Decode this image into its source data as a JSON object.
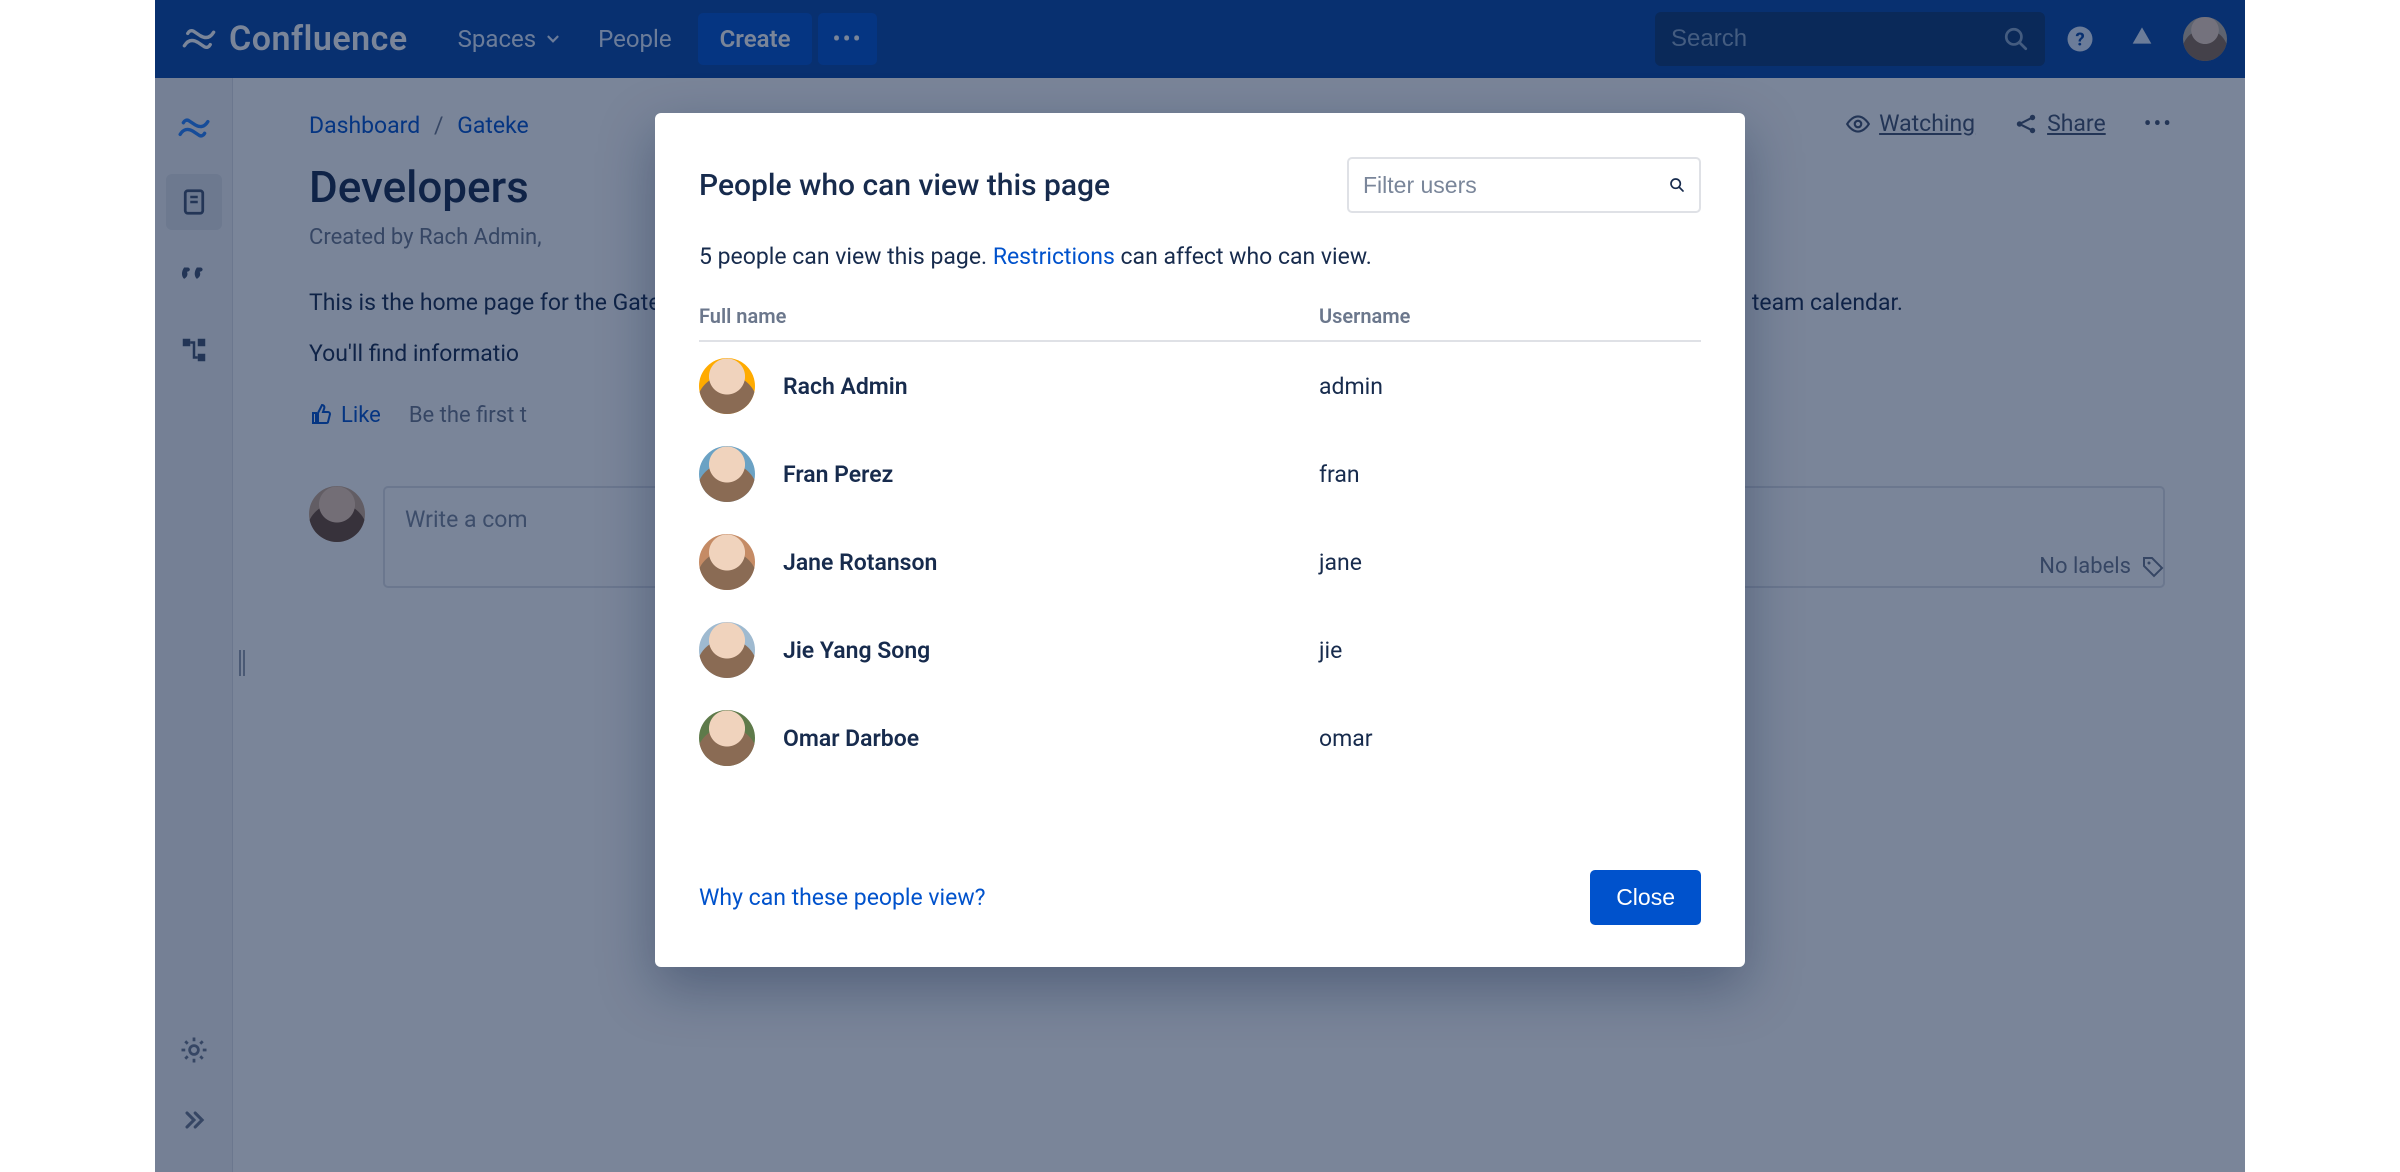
{
  "topnav": {
    "logo_text": "Confluence",
    "spaces": "Spaces",
    "people": "People",
    "create": "Create",
    "search_placeholder": "Search"
  },
  "breadcrumbs": {
    "item0": "Dashboard",
    "item1": "Gateke"
  },
  "page_actions": {
    "watching": "Watching",
    "share": "Share"
  },
  "page": {
    "title": "Developers",
    "meta": "Created by Rach Admin,",
    "para1": "This is the home page for the Gatekeeper Developer's team. This space contains our product requirements and technical specs, roadmap and team calendar.",
    "para2": "You'll find informatio",
    "like": "Like",
    "be_first": "Be the first t",
    "no_labels": "No labels",
    "comment_placeholder": "Write a com"
  },
  "dialog": {
    "title": "People who can view this page",
    "filter_placeholder": "Filter users",
    "desc_pre": "5 people can view this page. ",
    "desc_link": "Restrictions",
    "desc_post": " can affect who can view.",
    "col_name": "Full name",
    "col_user": "Username",
    "users": [
      {
        "name": "Rach Admin",
        "username": "admin"
      },
      {
        "name": "Fran Perez",
        "username": "fran"
      },
      {
        "name": "Jane Rotanson",
        "username": "jane"
      },
      {
        "name": "Jie Yang Song",
        "username": "jie"
      },
      {
        "name": "Omar Darboe",
        "username": "omar"
      }
    ],
    "why_link": "Why can these people view?",
    "close": "Close"
  }
}
